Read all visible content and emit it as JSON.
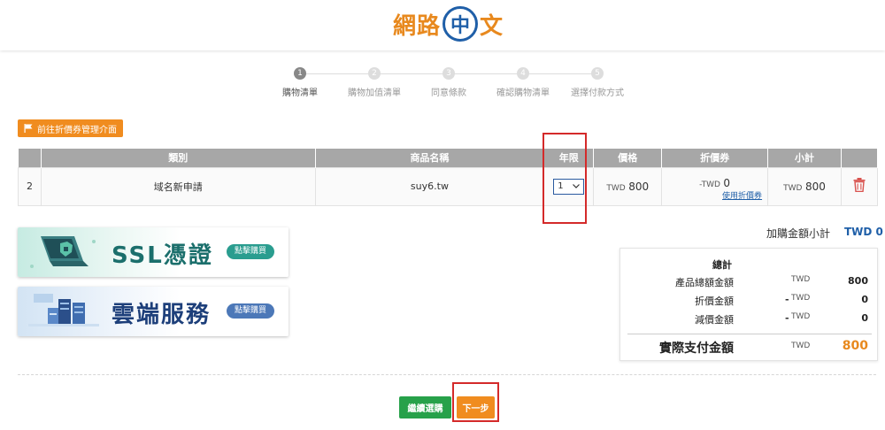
{
  "header": {
    "logo_left": "網路",
    "logo_mid": "中",
    "logo_right": "文"
  },
  "steps": [
    {
      "num": "1",
      "label": "購物清單",
      "active": true
    },
    {
      "num": "2",
      "label": "購物加值清單",
      "active": false
    },
    {
      "num": "3",
      "label": "同意條款",
      "active": false
    },
    {
      "num": "4",
      "label": "確認購物清單",
      "active": false
    },
    {
      "num": "5",
      "label": "選擇付款方式",
      "active": false
    }
  ],
  "coupon_button": "前往折價券管理介面",
  "table": {
    "headers": [
      "類別",
      "商品名稱",
      "年限",
      "價格",
      "折價券",
      "小計"
    ],
    "row": {
      "index": "2",
      "category": "域名新申請",
      "product": "suy6.tw",
      "years": "1",
      "price_currency": "TWD",
      "price": "800",
      "discount_prefix": "-TWD",
      "discount": "0",
      "use_coupon": "使用折價券",
      "subtotal_currency": "TWD",
      "subtotal": "800"
    }
  },
  "banners": {
    "ssl_title": "SSL憑證",
    "ssl_button": "點擊購買",
    "cloud_title": "雲端服務",
    "cloud_button": "點擊購買"
  },
  "addon": {
    "label": "加購金額小計",
    "value": "TWD 0"
  },
  "summary": {
    "title": "總計",
    "product_total_label": "產品總額金額",
    "product_total_currency": "TWD",
    "product_total_value": "800",
    "discount_label": "折價金額",
    "discount_sign": "-",
    "discount_currency": "TWD",
    "discount_value": "0",
    "reduce_label": "減價金額",
    "reduce_sign": "-",
    "reduce_currency": "TWD",
    "reduce_value": "0",
    "actual_label": "實際支付金額",
    "actual_currency": "TWD",
    "actual_value": "800"
  },
  "buttons": {
    "continue": "繼續選購",
    "next": "下一步"
  },
  "colors": {
    "brand_orange": "#f08c1f",
    "brand_blue": "#1f5fa8",
    "green": "#27a14a",
    "highlight_red": "#d42a2a"
  }
}
